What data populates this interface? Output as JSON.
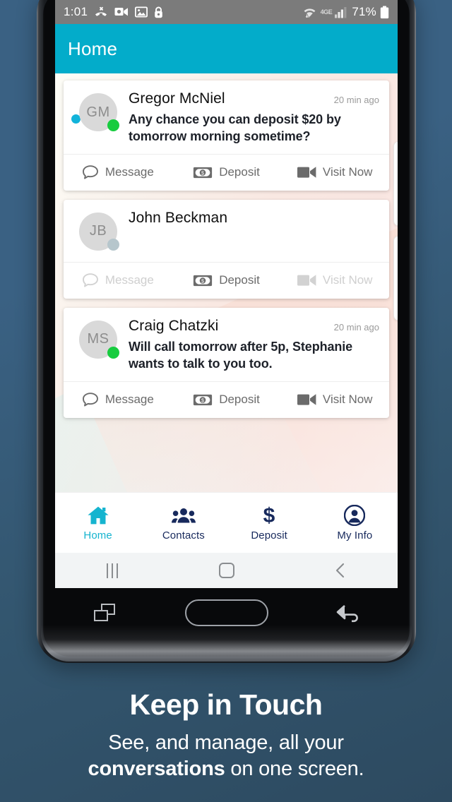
{
  "status_bar": {
    "clock": "1:01",
    "battery_percent": "71%",
    "network_label": "4GE",
    "left_icons": [
      "missed-call-icon",
      "video-message-icon",
      "photo-icon",
      "lock-icon"
    ],
    "right_icons": [
      "wifi-transfer-icon",
      "signal-bars-icon",
      "battery-icon"
    ],
    "background": "#7b7b7b"
  },
  "app_bar": {
    "title": "Home",
    "background": "#03acca"
  },
  "conversations": [
    {
      "initials": "GM",
      "name": "Gregor McNiel",
      "time": "20 min ago",
      "preview": "Any chance you can deposit $20 by tomorrow morning sometime?",
      "unread": true,
      "presence": "online",
      "actions": [
        {
          "label": "Message",
          "icon": "message-bubble-icon",
          "enabled": true
        },
        {
          "label": "Deposit",
          "icon": "money-bill-icon",
          "enabled": true
        },
        {
          "label": "Visit Now",
          "icon": "video-camera-icon",
          "enabled": true
        }
      ]
    },
    {
      "initials": "JB",
      "name": "John Beckman",
      "time": "",
      "preview": "",
      "unread": false,
      "presence": "offline",
      "actions": [
        {
          "label": "Message",
          "icon": "message-bubble-icon",
          "enabled": false
        },
        {
          "label": "Deposit",
          "icon": "money-bill-icon",
          "enabled": true
        },
        {
          "label": "Visit Now",
          "icon": "video-camera-icon",
          "enabled": false
        }
      ]
    },
    {
      "initials": "MS",
      "name": "Craig Chatzki",
      "time": "20 min ago",
      "preview": "Will call tomorrow after 5p, Stephanie wants to talk to you too.",
      "unread": false,
      "presence": "online",
      "actions": [
        {
          "label": "Message",
          "icon": "message-bubble-icon",
          "enabled": true
        },
        {
          "label": "Deposit",
          "icon": "money-bill-icon",
          "enabled": true
        },
        {
          "label": "Visit Now",
          "icon": "video-camera-icon",
          "enabled": true
        }
      ]
    }
  ],
  "tab_bar": {
    "active_color": "#15b4cf",
    "inactive_color": "#17295c",
    "items": [
      {
        "label": "Home",
        "icon": "home-icon",
        "active": true
      },
      {
        "label": "Contacts",
        "icon": "people-icon",
        "active": false
      },
      {
        "label": "Deposit",
        "icon": "dollar-sign-icon",
        "active": false
      },
      {
        "label": "My Info",
        "icon": "person-circle-icon",
        "active": false
      }
    ]
  },
  "android_nav": {
    "items": [
      "recents-icon",
      "home-icon",
      "back-icon"
    ]
  },
  "hardware_keys": {
    "items": [
      "recent-apps-key",
      "home-key",
      "back-key"
    ]
  },
  "caption": {
    "title": "Keep in Touch",
    "line1": "See, and manage, all your",
    "line2_bold": "conversations",
    "line2_rest": " on one screen."
  }
}
